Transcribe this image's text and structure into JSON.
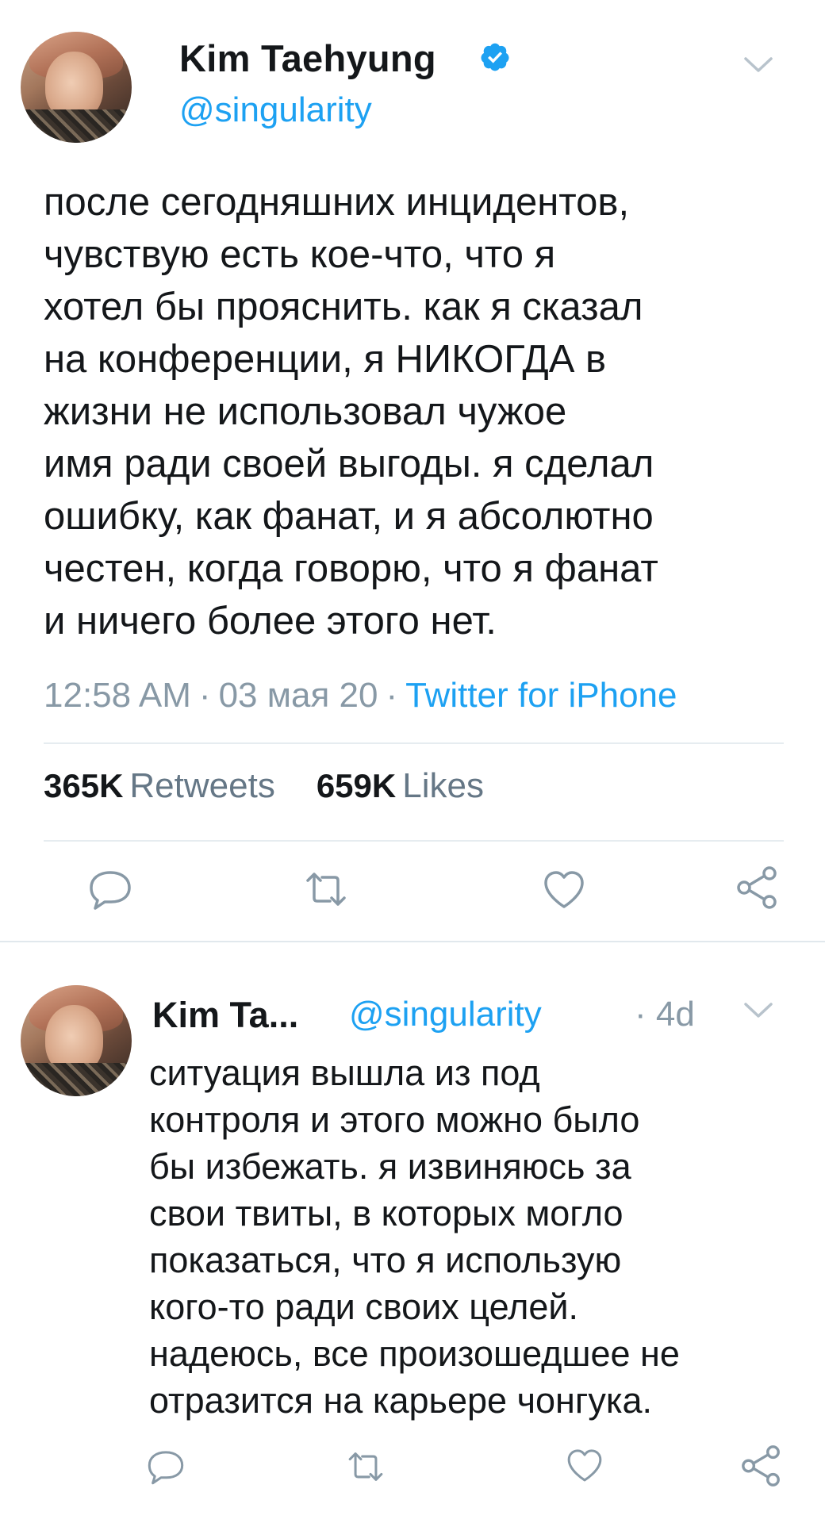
{
  "colors": {
    "accent": "#1da1f2",
    "text": "#14171a",
    "muted": "#8899a6",
    "divider": "#e6ecf0"
  },
  "main_tweet": {
    "avatar_icon": "profile-avatar",
    "name": "Kim Taehyung",
    "verified_icon": "verified-badge-icon",
    "handle": "@singularity",
    "menu_icon": "chevron-down-icon",
    "text_lines": [
      "после сегодняшних инцидентов,",
      "чувствую есть кое-что, что я",
      "хотел бы прояснить. как я сказал",
      "на конференции, я НИКОГДА в",
      "жизни не использовал чужое",
      "имя ради своей выгоды. я сделал",
      "ошибку, как фанат, и я абсолютно",
      "честен, когда говорю, что я фанат",
      "и ничего более этого нет."
    ],
    "time": "12:58 AM",
    "date": "03 мая 20",
    "separator": "·",
    "source": "Twitter for iPhone",
    "retweets_count": "365K",
    "retweets_label": "Retweets",
    "likes_count": "659K",
    "likes_label": "Likes",
    "actions": [
      "reply-icon",
      "retweet-icon",
      "like-icon",
      "share-icon"
    ]
  },
  "reply_tweet": {
    "avatar_icon": "profile-avatar",
    "name": "Kim Ta...",
    "handle": "@singularity",
    "time": "· 4d",
    "menu_icon": "chevron-down-icon",
    "text_lines": [
      "ситуация вышла из под",
      "контроля и этого можно было",
      "бы избежать. я извиняюсь за",
      "свои твиты, в которых могло",
      "показаться, что я использую",
      "кого-то ради своих целей.",
      "надеюсь, все произошедшее не",
      "отразится на карьере чонгука."
    ],
    "actions": [
      "reply-icon",
      "retweet-icon",
      "like-icon",
      "share-icon"
    ]
  }
}
